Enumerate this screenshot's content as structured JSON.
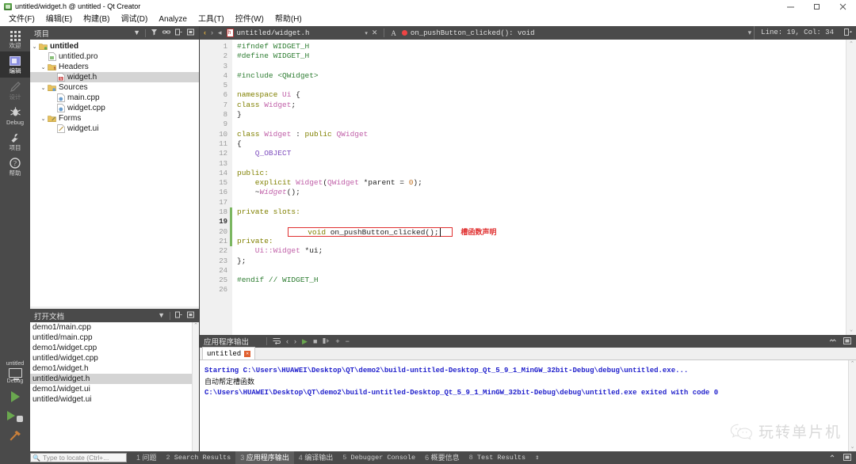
{
  "window": {
    "title": "untitled/widget.h @ untitled - Qt Creator",
    "app_icon": "qt-creator-icon",
    "controls": {
      "minimize": "minimize-icon",
      "maximize": "maximize-icon",
      "close": "close-icon"
    }
  },
  "menubar": {
    "items": [
      {
        "label": "文件(F)"
      },
      {
        "label": "编辑(E)"
      },
      {
        "label": "构建(B)"
      },
      {
        "label": "调试(D)"
      },
      {
        "label": "Analyze"
      },
      {
        "label": "工具(T)"
      },
      {
        "label": "控件(W)"
      },
      {
        "label": "帮助(H)"
      }
    ]
  },
  "modebar": {
    "modes": [
      {
        "label": "欢迎",
        "icon": "grid-icon",
        "state": "normal"
      },
      {
        "label": "编辑",
        "icon": "edit-icon",
        "state": "active"
      },
      {
        "label": "设计",
        "icon": "pencil-icon",
        "state": "disabled"
      },
      {
        "label": "Debug",
        "icon": "bug-icon",
        "state": "normal"
      },
      {
        "label": "项目",
        "icon": "wrench-icon",
        "state": "normal"
      },
      {
        "label": "帮助",
        "icon": "question-icon",
        "state": "normal"
      }
    ],
    "run_target": {
      "project": "untitled",
      "kit": "Debug",
      "icon": "monitor-icon"
    },
    "actions": [
      {
        "name": "run-button",
        "icon": "play-icon"
      },
      {
        "name": "debug-button",
        "icon": "play-debug-icon"
      },
      {
        "name": "build-button",
        "icon": "hammer-icon"
      }
    ]
  },
  "project_panel": {
    "title": "项目",
    "tools": [
      {
        "name": "filter-icon",
        "glyph": "▼"
      },
      {
        "name": "link-icon",
        "glyph": "⛓"
      },
      {
        "name": "expand-icon",
        "glyph": "⊞"
      },
      {
        "name": "close-split-icon",
        "glyph": "▣"
      }
    ],
    "tree": [
      {
        "label": "untitled",
        "indent": 0,
        "chevron": "v",
        "icon": "project-icon",
        "bold": true,
        "selected": false
      },
      {
        "label": "untitled.pro",
        "indent": 1,
        "chevron": "",
        "icon": "pro-file-icon",
        "bold": false,
        "selected": false
      },
      {
        "label": "Headers",
        "indent": 1,
        "chevron": "v",
        "icon": "headers-icon",
        "bold": false,
        "selected": false
      },
      {
        "label": "widget.h",
        "indent": 2,
        "chevron": "",
        "icon": "h-file-icon",
        "bold": false,
        "selected": true
      },
      {
        "label": "Sources",
        "indent": 1,
        "chevron": "v",
        "icon": "sources-icon",
        "bold": false,
        "selected": false
      },
      {
        "label": "main.cpp",
        "indent": 2,
        "chevron": "",
        "icon": "cpp-file-icon",
        "bold": false,
        "selected": false
      },
      {
        "label": "widget.cpp",
        "indent": 2,
        "chevron": "",
        "icon": "cpp-file-icon",
        "bold": false,
        "selected": false
      },
      {
        "label": "Forms",
        "indent": 1,
        "chevron": "v",
        "icon": "forms-icon",
        "bold": false,
        "selected": false
      },
      {
        "label": "widget.ui",
        "indent": 2,
        "chevron": "",
        "icon": "ui-file-icon",
        "bold": false,
        "selected": false
      }
    ]
  },
  "open_documents": {
    "title": "打开文档",
    "tools": [
      {
        "name": "dropdown-icon",
        "glyph": "▼"
      },
      {
        "name": "split-icon",
        "glyph": "⊞"
      },
      {
        "name": "close-panel-icon",
        "glyph": "▣"
      }
    ],
    "items": [
      {
        "label": "demo1/main.cpp",
        "selected": false
      },
      {
        "label": "untitled/main.cpp",
        "selected": false
      },
      {
        "label": "demo1/widget.cpp",
        "selected": false
      },
      {
        "label": "untitled/widget.cpp",
        "selected": false
      },
      {
        "label": "demo1/widget.h",
        "selected": false
      },
      {
        "label": "untitled/widget.h",
        "selected": true
      },
      {
        "label": "demo1/widget.ui",
        "selected": false
      },
      {
        "label": "untitled/widget.ui",
        "selected": false
      }
    ]
  },
  "editor_toolbar": {
    "back_icon": "back-chevron-icon",
    "forward_icon": "forward-chevron-icon",
    "file_icon": "h-file-icon",
    "file_name": "untitled/widget.h",
    "file_dropdown_icon": "chevron-down-icon",
    "close_icon": "close-icon",
    "symbol_marker": "A",
    "symbol_icon": "slot-icon",
    "symbol_name": "on_pushButton_clicked(): void",
    "line_col": "Line: 19, Col: 34",
    "split_icon": "split-editor-icon"
  },
  "code": {
    "lines": [
      {
        "n": 1,
        "fold": "",
        "change": false,
        "current": false
      },
      {
        "n": 2,
        "fold": "",
        "change": false,
        "current": false
      },
      {
        "n": 3,
        "fold": "",
        "change": false,
        "current": false
      },
      {
        "n": 4,
        "fold": "",
        "change": false,
        "current": false
      },
      {
        "n": 5,
        "fold": "",
        "change": false,
        "current": false
      },
      {
        "n": 6,
        "fold": "v",
        "change": false,
        "current": false
      },
      {
        "n": 7,
        "fold": "",
        "change": false,
        "current": false
      },
      {
        "n": 8,
        "fold": "",
        "change": false,
        "current": false
      },
      {
        "n": 9,
        "fold": "",
        "change": false,
        "current": false
      },
      {
        "n": 10,
        "fold": "v",
        "change": false,
        "current": false
      },
      {
        "n": 11,
        "fold": "",
        "change": false,
        "current": false
      },
      {
        "n": 12,
        "fold": "",
        "change": false,
        "current": false
      },
      {
        "n": 13,
        "fold": "",
        "change": false,
        "current": false
      },
      {
        "n": 14,
        "fold": "",
        "change": false,
        "current": false
      },
      {
        "n": 15,
        "fold": "",
        "change": false,
        "current": false
      },
      {
        "n": 16,
        "fold": "",
        "change": false,
        "current": false
      },
      {
        "n": 17,
        "fold": "",
        "change": false,
        "current": false
      },
      {
        "n": 18,
        "fold": "",
        "change": true,
        "current": false
      },
      {
        "n": 19,
        "fold": "",
        "change": true,
        "current": true
      },
      {
        "n": 20,
        "fold": "",
        "change": true,
        "current": false
      },
      {
        "n": 21,
        "fold": "",
        "change": true,
        "current": false
      },
      {
        "n": 22,
        "fold": "",
        "change": false,
        "current": false
      },
      {
        "n": 23,
        "fold": "",
        "change": false,
        "current": false
      },
      {
        "n": 24,
        "fold": "",
        "change": false,
        "current": false
      },
      {
        "n": 25,
        "fold": "",
        "change": false,
        "current": false
      },
      {
        "n": 26,
        "fold": "",
        "change": false,
        "current": false
      }
    ],
    "text": {
      "l1": "#ifndef WIDGET_H",
      "l2": "#define WIDGET_H",
      "l4a": "#include ",
      "l4b": "<QWidget>",
      "l6a": "namespace ",
      "l6b": "Ui",
      "l6c": " {",
      "l7a": "class ",
      "l7b": "Widget",
      "l7c": ";",
      "l8": "}",
      "l10a": "class ",
      "l10b": "Widget",
      "l10c": " : ",
      "l10d": "public ",
      "l10e": "QWidget",
      "l11": "{",
      "l12": "    Q_OBJECT",
      "l14": "public:",
      "l15a": "    explicit ",
      "l15b": "Widget",
      "l15c": "(",
      "l15d": "QWidget",
      "l15e": " *parent = ",
      "l15f": "0",
      "l15g": ");",
      "l16a": "    ~",
      "l16b": "Widget",
      "l16c": "();",
      "l18": "private slots:",
      "l19a": "    void ",
      "l19b": "on_pushButton_clicked();",
      "l21": "private:",
      "l22a": "    Ui::",
      "l22b": "Widget",
      "l22c": " *ui;",
      "l23": "};",
      "l25a": "#endif ",
      "l25b": "// WIDGET_H"
    },
    "annotation": "槽函数声明",
    "annotation_color": "#e03030",
    "highlight_box_color": "#e03030"
  },
  "output_pane": {
    "title": "应用程序输出",
    "tools": [
      {
        "name": "word-wrap-icon",
        "glyph": "⇲"
      },
      {
        "name": "prev-icon",
        "glyph": "‹"
      },
      {
        "name": "next-icon",
        "glyph": "›"
      },
      {
        "name": "run-icon",
        "glyph": "▶"
      },
      {
        "name": "stop-icon",
        "glyph": "■"
      },
      {
        "name": "attach-icon",
        "glyph": "▮"
      },
      {
        "name": "zoom-in-icon",
        "glyph": "+"
      },
      {
        "name": "zoom-out-icon",
        "glyph": "−"
      }
    ],
    "right_tools": [
      {
        "name": "maximize-pane-icon",
        "glyph": "▲"
      },
      {
        "name": "close-pane-icon",
        "glyph": "▣"
      }
    ],
    "tabs": [
      {
        "label": "untitled",
        "close_icon": "close-tab-icon",
        "active": true
      }
    ],
    "lines": [
      {
        "text": "Starting C:\\Users\\HUAWEI\\Desktop\\QT\\demo2\\build-untitled-Desktop_Qt_5_9_1_MinGW_32bit-Debug\\debug\\untitled.exe...",
        "style": "mono"
      },
      {
        "text": "自动帮定槽函数",
        "style": "cn"
      },
      {
        "text": "C:\\Users\\HUAWEI\\Desktop\\QT\\demo2\\build-untitled-Desktop_Qt_5_9_1_MinGW_32bit-Debug\\debug\\untitled.exe exited with code 0",
        "style": "mono"
      }
    ],
    "text_color": "#2020cc"
  },
  "watermark": {
    "text": "玩转单片机",
    "logo": "wechat-icon"
  },
  "statusbar": {
    "locate_placeholder": "Type to locate (Ctrl+...",
    "search_icon": "search-icon",
    "items": [
      {
        "num": "1",
        "label": "问题",
        "active": false,
        "cn": true
      },
      {
        "num": "2",
        "label": "Search Results",
        "active": false,
        "cn": false
      },
      {
        "num": "3",
        "label": "应用程序输出",
        "active": true,
        "cn": true
      },
      {
        "num": "4",
        "label": "编译输出",
        "active": false,
        "cn": true
      },
      {
        "num": "5",
        "label": "Debugger Console",
        "active": false,
        "cn": false
      },
      {
        "num": "6",
        "label": "概要信息",
        "active": false,
        "cn": true
      },
      {
        "num": "8",
        "label": "Test Results",
        "active": false,
        "cn": false
      }
    ],
    "resize_icon": "resize-grip-icon"
  },
  "colors": {
    "chrome_dark": "#4a4a4a",
    "chrome_darker": "#3c3c3c",
    "selection": "#d4d4d4",
    "accent_green": "#6aa84f",
    "annotation_red": "#e03030",
    "output_blue": "#2020cc"
  }
}
